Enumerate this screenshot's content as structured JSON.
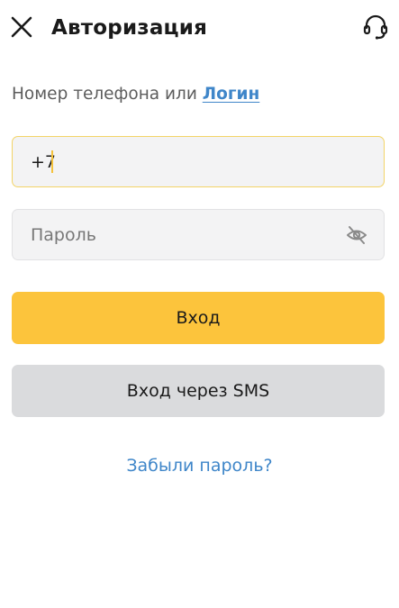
{
  "header": {
    "title": "Авторизация"
  },
  "login_prompt": {
    "text": "Номер телефона или ",
    "link": "Логин"
  },
  "phone_field": {
    "value": "+7"
  },
  "password_field": {
    "placeholder": "Пароль"
  },
  "buttons": {
    "login": "Вход",
    "login_sms": "Вход через SMS"
  },
  "forgot_password": "Забыли пароль?",
  "colors": {
    "accent_yellow": "#fcc43c",
    "link_blue": "#3f86c9",
    "secondary_gray": "#dadbdd",
    "field_bg": "#f3f3f4"
  }
}
